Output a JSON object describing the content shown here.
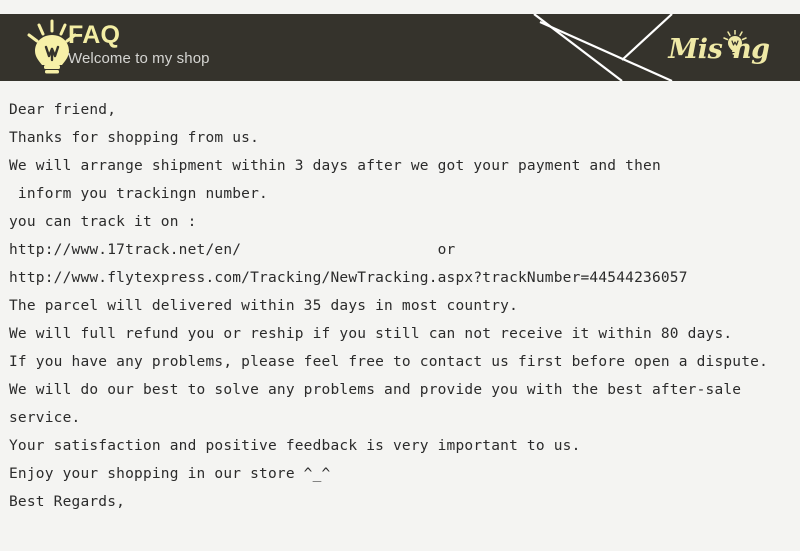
{
  "header": {
    "title": "FAQ",
    "subtitle": "Welcome to my shop",
    "bulb_icon_name": "lightbulb-icon",
    "brand": {
      "text_before": "Mis",
      "text_after": "ng",
      "full_text": "Mising",
      "bulb_icon_name": "lightbulb-icon"
    },
    "colors": {
      "banner_background": "#35332c",
      "title": "#f3eda4",
      "subtitle": "#d5d5d2",
      "brand": "#efe9a6",
      "deco_line": "#ffffff",
      "bulb": "#f7f0a8"
    }
  },
  "page": {
    "background": "#f4f4f2",
    "text_color": "#2b2b2b"
  },
  "letter": {
    "lines": [
      "Dear friend,",
      "Thanks for shopping from us.",
      "We will arrange shipment within 3 days after we got your payment and then",
      " inform you trackingn number.",
      "you can track it on :",
      "http://www.17track.net/en/                      or",
      "http://www.flytexpress.com/Tracking/NewTracking.aspx?trackNumber=44544236057",
      "The parcel will delivered within 35 days in most country.",
      "We will full refund you or reship if you still can not receive it within 80 days.",
      "If you have any problems, please feel free to contact us first before open a dispute.",
      "We will do our best to solve any problems and provide you with the best after-sale",
      "service.",
      "Your satisfaction and positive feedback is very important to us.",
      "Enjoy your shopping in our store ^_^",
      "Best Regards,"
    ],
    "tracking_number": "44544236057",
    "tracking_url_primary": "http://www.17track.net/en/",
    "tracking_url_secondary": "http://www.flytexpress.com/Tracking/NewTracking.aspx?trackNumber=44544236057",
    "shipment_days": "3",
    "delivery_days": "35",
    "refund_days": "80"
  }
}
